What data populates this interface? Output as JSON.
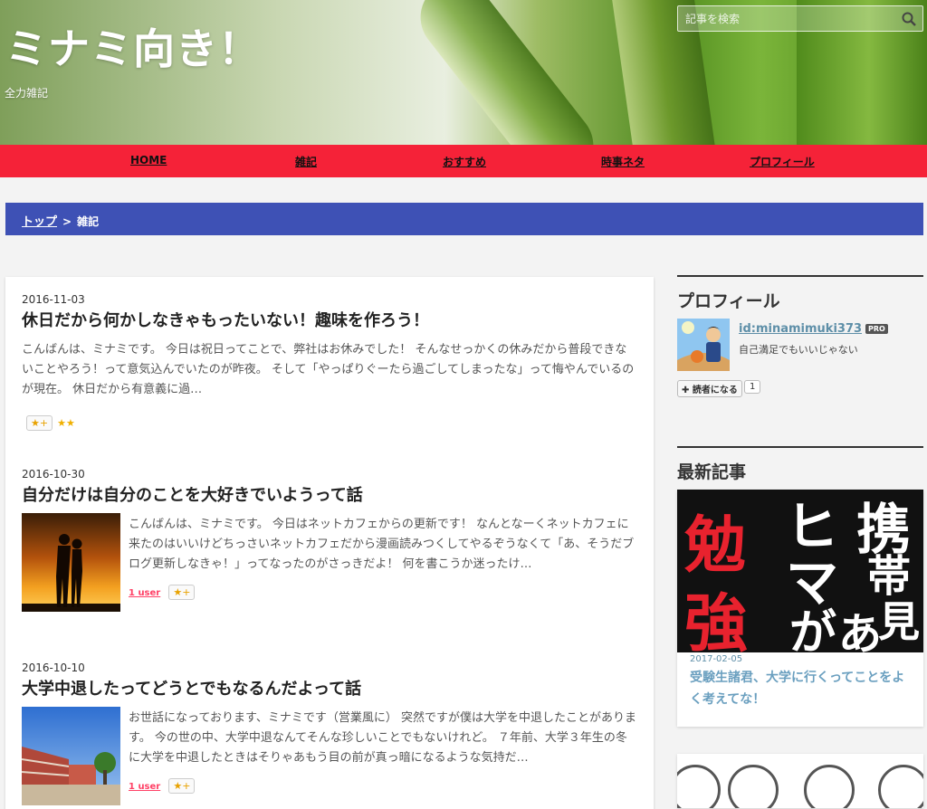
{
  "header": {
    "title": "ミナミ向き！",
    "description": "全力雑記",
    "search_placeholder": "記事を検索"
  },
  "nav": {
    "items": [
      "HOME",
      "雑記",
      "おすすめ",
      "時事ネタ",
      "プロフィール"
    ]
  },
  "breadcrumb": {
    "top": "トップ",
    "separator": ">",
    "current": "雑記"
  },
  "entries": [
    {
      "date": "2016-11-03",
      "title": "休日だから何かしなきゃもったいない！趣味を作ろう！",
      "summary": "こんばんは、ミナミです。 今日は祝日ってことで、弊社はお休みでした！ そんなせっかくの休みだから普段できないことやろう！って意気込んでいたのが昨夜。 そして「やっぱりぐーたら過ごしてしまったな」って悔やんでいるのが現在。 休日だから有意義に過…",
      "star_button": "★+",
      "stars": "★★"
    },
    {
      "date": "2016-10-30",
      "title": "自分だけは自分のことを大好きでいようって話",
      "summary": "こんばんは、ミナミです。 今日はネットカフェからの更新です！ なんとなーくネットカフェに来たのはいいけどちっさいネットカフェだから漫画読みつくしてやるぞうなくて「あ、そうだブログ更新しなきゃ！」ってなったのがさっきだよ！ 何を書こうか迷ったけ…",
      "users": "1 user",
      "star_button": "★+"
    },
    {
      "date": "2016-10-10",
      "title": "大学中退したってどうとでもなるんだよって話",
      "summary": "お世話になっております、ミナミです（営業風に） 突然ですが僕は大学を中退したことがあります。 今の世の中、大学中退なんてそんな珍しいことでもないけれど。 ７年前、大学３年生の冬に大学を中退したときはそりゃあもう目の前が真っ暗になるような気持だ…",
      "users": "1 user",
      "star_button": "★+"
    }
  ],
  "sidebar": {
    "profile": {
      "heading": "プロフィール",
      "id": "id:minamimuki373",
      "badge": "PRO",
      "description": "自己満足でもいいじゃない",
      "reader_button": "読者になる",
      "reader_count": "1"
    },
    "recent": {
      "heading": "最新記事",
      "date": "2017-02-05",
      "title": "受験生諸君、大学に行くってことをよく考えてな！",
      "image_text": [
        "勉",
        "強",
        "ヒ",
        "マ",
        "が",
        "あ",
        "携",
        "帯",
        "見"
      ]
    }
  },
  "colors": {
    "nav": "#f52238",
    "breadcrumb": "#3e51b5",
    "link": "#5e8fa8"
  }
}
